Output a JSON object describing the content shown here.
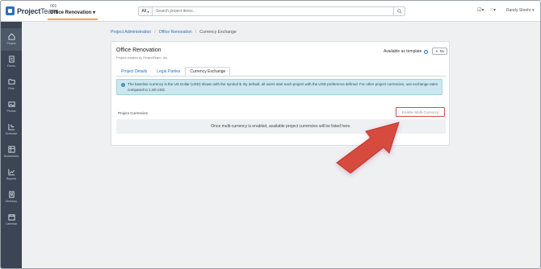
{
  "app": {
    "logo_text_bold": "Project",
    "logo_text_rest": "Team"
  },
  "project_switcher": {
    "number": "001",
    "name": "Office Renovation"
  },
  "search": {
    "scope": "All",
    "placeholder": "Search project items..."
  },
  "user": {
    "name": "Randy Stoehr"
  },
  "sidebar": {
    "items": [
      {
        "label": "Project",
        "icon": "home-icon"
      },
      {
        "label": "Forms",
        "icon": "form-icon"
      },
      {
        "label": "Files",
        "icon": "folder-icon"
      },
      {
        "label": "Photos",
        "icon": "photo-icon"
      },
      {
        "label": "Schedule",
        "icon": "schedule-icon"
      },
      {
        "label": "Worksheets",
        "icon": "worksheet-icon"
      },
      {
        "label": "Reports",
        "icon": "report-icon"
      },
      {
        "label": "Directory",
        "icon": "directory-icon"
      },
      {
        "label": "Calendar",
        "icon": "calendar-icon"
      }
    ]
  },
  "breadcrumb": {
    "items": [
      "Project Administration",
      "Office Renovation",
      "Currency Exchange"
    ],
    "separator": "/"
  },
  "card": {
    "title": "Office Renovation",
    "subtitle": "Project created by ProjectTeam, Inc.",
    "template_label": "Available as template",
    "toggle_label": "No",
    "toggle_mark": "✕"
  },
  "tabs": [
    "Project Details",
    "Legal Parties",
    "Currency Exchange"
  ],
  "info": {
    "text": "The baseline currency is the US Dollar (USD) shown with the symbol $. By default, all users start each project with the USD preference defined. For other project currencies, use exchange rates compared to 1.00 USD."
  },
  "currencies": {
    "label": "Project Currencies",
    "button": "Enable Multi-Currency",
    "empty_text": "Once multi-currency is enabled, available project currencies will be listed here."
  },
  "colors": {
    "accent": "#2d6fb8",
    "sidebar": "#3b4554",
    "highlight_border": "#d9474c",
    "arrow": "#d64b3c",
    "info_bg": "#cbe7f0",
    "project_underline": "#f0a83b"
  }
}
